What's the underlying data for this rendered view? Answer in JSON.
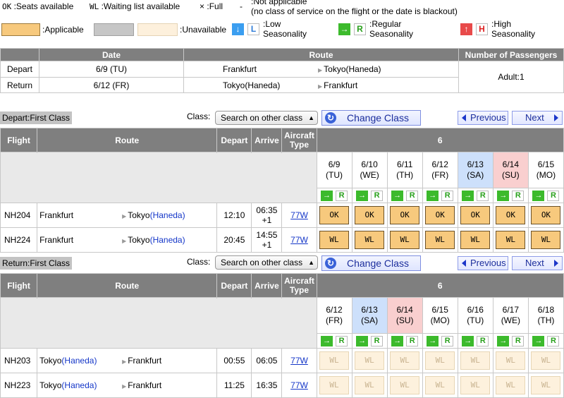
{
  "legend": {
    "ok_code": "OK",
    "ok_text": ":Seats available",
    "wl_code": "WL",
    "wl_text": ":Waiting list available",
    "full_code": "×",
    "full_text": ":Full",
    "na_code": "-",
    "na_text_1": ":Not applicable",
    "na_text_2": "(no class of service on the flight or the date is blackout)",
    "applicable": ":Applicable",
    "unavailable": ":Unavailable",
    "low_1": ":Low",
    "low_2": "Seasonality",
    "low_letter": "L",
    "regular_1": ":Regular",
    "regular_2": "Seasonality",
    "regular_letter": "R",
    "high_1": ":High",
    "high_2": "Seasonality",
    "high_letter": "H"
  },
  "summary": {
    "headers": [
      "Date",
      "Route",
      "Number of Passengers"
    ],
    "rows": [
      {
        "label": "Depart",
        "date": "6/9 (TU)",
        "from": "Frankfurt",
        "to": "Tokyo(Haneda)"
      },
      {
        "label": "Return",
        "date": "6/12 (FR)",
        "from": "Tokyo(Haneda)",
        "to": "Frankfurt"
      }
    ],
    "passengers": "Adult:1"
  },
  "controls": {
    "class_label": "Class:",
    "class_select": "Search on other class",
    "change_class": "Change Class",
    "previous": "Previous",
    "next": "Next"
  },
  "columns": {
    "flight": "Flight",
    "route": "Route",
    "depart": "Depart",
    "arrive": "Arrive",
    "aircraft_1": "Aircraft",
    "aircraft_2": "Type",
    "month": "6"
  },
  "depart": {
    "title": "Depart:First Class",
    "dates": [
      {
        "d": "6/9",
        "w": "(TU)",
        "tone": ""
      },
      {
        "d": "6/10",
        "w": "(WE)",
        "tone": ""
      },
      {
        "d": "6/11",
        "w": "(TH)",
        "tone": ""
      },
      {
        "d": "6/12",
        "w": "(FR)",
        "tone": ""
      },
      {
        "d": "6/13",
        "w": "(SA)",
        "tone": "sa"
      },
      {
        "d": "6/14",
        "w": "(SU)",
        "tone": "su"
      },
      {
        "d": "6/15",
        "w": "(MO)",
        "tone": ""
      }
    ],
    "flights": [
      {
        "no": "NH204",
        "from": "Frankfurt",
        "to_city": "Tokyo",
        "to_airport": "(Haneda)",
        "dep": "12:10",
        "arr": "06:35",
        "arr_day": "+1",
        "type": "77W",
        "status": [
          "OK",
          "OK",
          "OK",
          "OK",
          "OK",
          "OK",
          "OK"
        ]
      },
      {
        "no": "NH224",
        "from": "Frankfurt",
        "to_city": "Tokyo",
        "to_airport": "(Haneda)",
        "dep": "20:45",
        "arr": "14:55",
        "arr_day": "+1",
        "type": "77W",
        "status": [
          "WL",
          "WL",
          "WL",
          "WL",
          "WL",
          "WL",
          "WL"
        ]
      }
    ]
  },
  "return": {
    "title": "Return:First Class",
    "dates": [
      {
        "d": "6/12",
        "w": "(FR)",
        "tone": ""
      },
      {
        "d": "6/13",
        "w": "(SA)",
        "tone": "sa"
      },
      {
        "d": "6/14",
        "w": "(SU)",
        "tone": "su"
      },
      {
        "d": "6/15",
        "w": "(MO)",
        "tone": ""
      },
      {
        "d": "6/16",
        "w": "(TU)",
        "tone": ""
      },
      {
        "d": "6/17",
        "w": "(WE)",
        "tone": ""
      },
      {
        "d": "6/18",
        "w": "(TH)",
        "tone": ""
      }
    ],
    "flights": [
      {
        "no": "NH203",
        "from_city": "Tokyo",
        "from_airport": "(Haneda)",
        "to": "Frankfurt",
        "dep": "00:55",
        "arr": "06:05",
        "type": "77W",
        "status": [
          "WL",
          "WL",
          "WL",
          "WL",
          "WL",
          "WL",
          "WL"
        ]
      },
      {
        "no": "NH223",
        "from_city": "Tokyo",
        "from_airport": "(Haneda)",
        "to": "Frankfurt",
        "dep": "11:25",
        "arr": "16:35",
        "type": "77W",
        "status": [
          "WL",
          "WL",
          "WL",
          "WL",
          "WL",
          "WL",
          "WL"
        ]
      }
    ]
  },
  "colors": {
    "header_gray": "#7f7f7f",
    "applicable": "#f7c97d",
    "unavailable": "#fdf0dc",
    "saturday": "#cde0fb",
    "sunday": "#f9cfcf",
    "link_blue": "#1436c8"
  }
}
